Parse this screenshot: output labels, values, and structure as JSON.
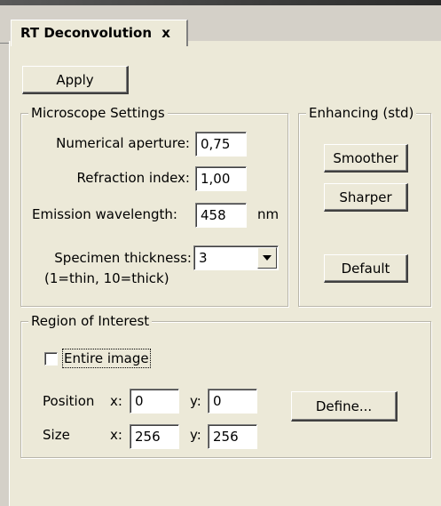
{
  "window": {
    "tab_title": "RT Deconvolution",
    "tab_close": "x",
    "close_glyph": "x"
  },
  "toolbar": {
    "apply_label": "Apply"
  },
  "microscope": {
    "group_title": "Microscope Settings",
    "na_label": "Numerical aperture:",
    "na_value": "0,75",
    "ri_label": "Refraction index:",
    "ri_value": "1,00",
    "wl_label": "Emission wavelength:",
    "wl_value": "458",
    "wl_unit": "nm",
    "thickness_label": "Specimen thickness:",
    "thickness_value": "3",
    "thickness_hint": "(1=thin, 10=thick)"
  },
  "enhancing": {
    "group_title": "Enhancing (std)",
    "smoother_label": "Smoother",
    "sharper_label": "Sharper",
    "default_label": "Default"
  },
  "roi": {
    "group_title": "Region of Interest",
    "entire_label": "Entire image",
    "entire_checked": false,
    "position_label": "Position",
    "size_label": "Size",
    "x_label": "x:",
    "y_label": "y:",
    "pos_x": "0",
    "pos_y": "0",
    "size_x": "256",
    "size_y": "256",
    "define_label": "Define..."
  }
}
